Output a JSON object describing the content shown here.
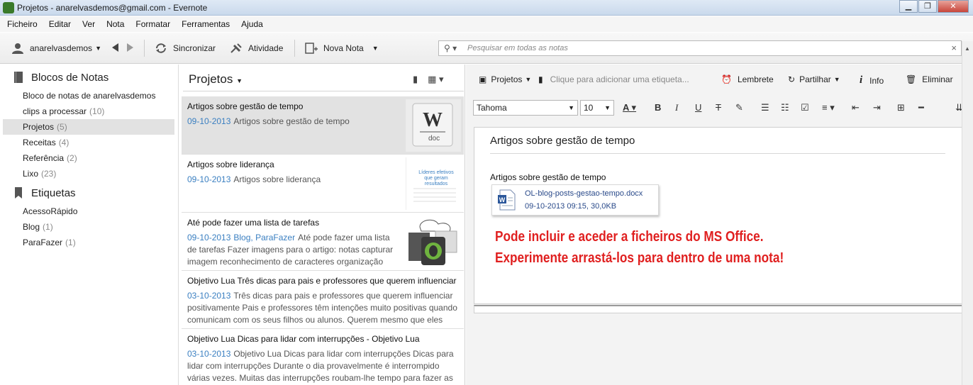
{
  "window": {
    "title": "Projetos - anarelvasdemos@gmail.com - Evernote",
    "minimize": "▁",
    "maximize": "❐",
    "close": "✕"
  },
  "menu": [
    "Ficheiro",
    "Editar",
    "Ver",
    "Nota",
    "Formatar",
    "Ferramentas",
    "Ajuda"
  ],
  "toolbar": {
    "user": "anarelvasdemos",
    "sync": "Sincronizar",
    "activity": "Atividade",
    "new_note": "Nova Nota",
    "search_placeholder": "Pesquisar em todas as notas"
  },
  "sidebar": {
    "notebooks_header": "Blocos de Notas",
    "notebooks": [
      {
        "name": "Bloco de notas de anarelvasdemos",
        "count": ""
      },
      {
        "name": "clips a processar",
        "count": "(10)"
      },
      {
        "name": "Projetos",
        "count": "(5)"
      },
      {
        "name": "Receitas",
        "count": "(4)"
      },
      {
        "name": "Referência",
        "count": "(2)"
      },
      {
        "name": "Lixo",
        "count": "(23)"
      }
    ],
    "tags_header": "Etiquetas",
    "tags": [
      {
        "name": "AcessoRápido",
        "count": ""
      },
      {
        "name": "Blog",
        "count": "(1)"
      },
      {
        "name": "ParaFazer",
        "count": "(1)"
      }
    ]
  },
  "notelist": {
    "header": "Projetos",
    "notes": [
      {
        "title": "Artigos sobre gestão de tempo",
        "date": "09-10-2013",
        "tags": "",
        "snippet": "Artigos sobre gestão de tempo",
        "thumb_label": "doc"
      },
      {
        "title": "Artigos sobre liderança",
        "date": "09-10-2013",
        "tags": "",
        "snippet": "Artigos sobre liderança",
        "thumb_label": "Líderes efetivos que geram resultados"
      },
      {
        "title": "Até pode fazer uma lista de tarefas",
        "date": "09-10-2013",
        "tags": "Blog, ParaFazer",
        "snippet": "Até pode fazer uma lista de tarefas Fazer imagens para o artigo: notas capturar imagem reconhecimento de caracteres organização e...",
        "thumb_label": ""
      },
      {
        "title": "Objetivo Lua Três dicas para pais e professores que querem influenciar",
        "date": "03-10-2013",
        "tags": "",
        "snippet": "Três dicas para pais e professores que querem influenciar positivamente Pais e professores têm intenções muito positivas quando comunicam com os seus filhos ou alunos. Querem mesmo que eles ul...",
        "thumb_label": ""
      },
      {
        "title": "Objetivo Lua Dicas para lidar com interrupções - Objetivo Lua",
        "date": "03-10-2013",
        "tags": "",
        "snippet": "Objetivo Lua Dicas para lidar com interrupções Dicas para lidar com interrupções Durante o dia provavelmente é interrompido várias vezes. Muitas das interrupções roubam-lhe tempo para fazer as ...",
        "thumb_label": ""
      }
    ]
  },
  "editor": {
    "notebook": "Projetos",
    "tag_placeholder": "Clique para adicionar uma etiqueta...",
    "reminder": "Lembrete",
    "share": "Partilhar",
    "info": "Info",
    "delete": "Eliminar",
    "font": "Tahoma",
    "size": "10",
    "note_title": "Artigos sobre gestão de tempo",
    "body_line": "Artigos sobre gestão de tempo",
    "attachment": {
      "name": "OL-blog-posts-gestao-tempo.docx",
      "meta": "09-10-2013 09:15, 30,0KB"
    },
    "red_line1": "Pode incluir e aceder a ficheiros do MS Office.",
    "red_line2": "Experimente arrastá-los para dentro de uma nota!"
  },
  "colors": {
    "accent_blue": "#3a7fc1",
    "red_text": "#e02020",
    "selection": "#e2e2e2"
  }
}
